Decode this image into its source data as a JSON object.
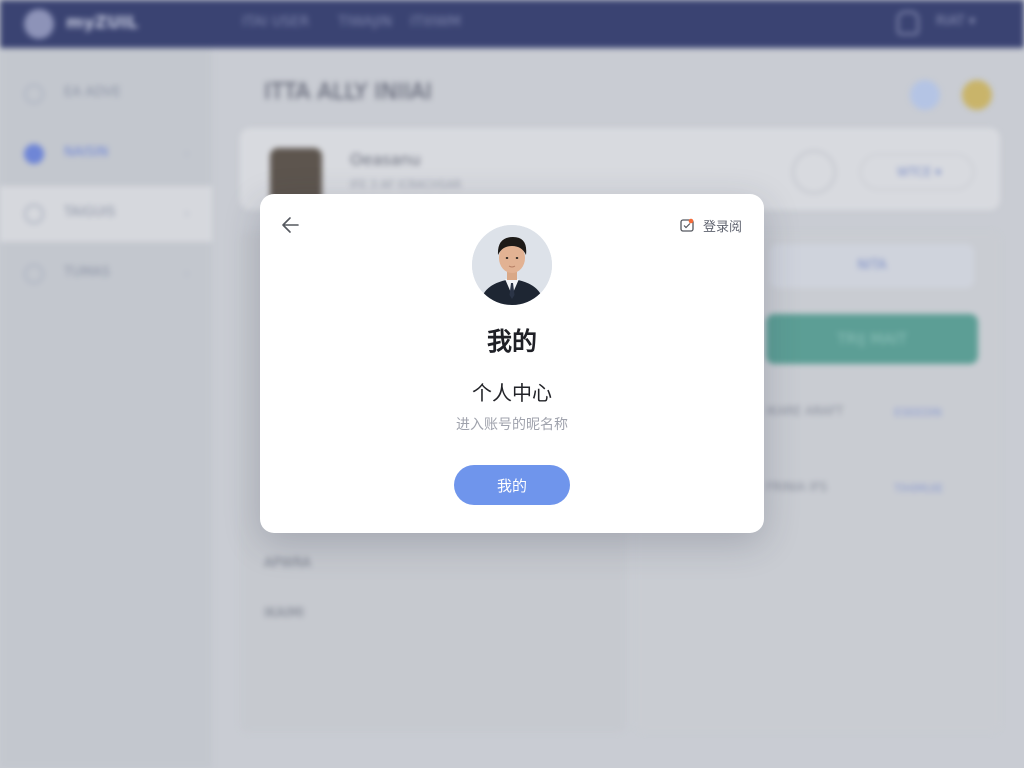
{
  "background_app": {
    "logo_text": "myZUIL",
    "nav_links": [
      "ITAI USER",
      "TIWAJIN",
      "ITIIIWM"
    ],
    "user_menu": "RIAT ▾",
    "sidebar_items": [
      {
        "label": "EA ADVE",
        "icon": "home-icon"
      },
      {
        "label": "NAISIN",
        "icon": "user-icon"
      },
      {
        "label": "TAIGUIS",
        "icon": "document-icon"
      },
      {
        "label": "TUMAS",
        "icon": "settings-icon"
      }
    ],
    "page_title": "ITTA ALLY INIIAI",
    "profile": {
      "name": "Oeasanu",
      "sub": "IFE 3 AF ICRACHSAR",
      "pill_label": "WTCE ▾"
    },
    "right_tab_label": "NITA",
    "green_button_label": "TRIJ MAIT",
    "right_rows": [
      {
        "label": "IKARE ARAFT",
        "link": "ESEEDIN"
      },
      {
        "label": "FRINIA IFS",
        "link": "TIHIMUIE"
      }
    ],
    "left_rows": [
      "APWRA",
      "IKAIMI"
    ],
    "colors": {
      "topbar": "#3a4372",
      "accent": "#6f86d6",
      "green": "#5c9e95"
    }
  },
  "modal": {
    "back_icon": "arrow-left-icon",
    "login_icon": "calendar-icon",
    "login_label": "登录阅",
    "title": "我的",
    "subtitle": "个人中心",
    "hint": "进入账号的昵名称",
    "primary_button_label": "我的",
    "colors": {
      "primary": "#6f95ec",
      "login_icon_dot": "#f26b3a"
    }
  }
}
